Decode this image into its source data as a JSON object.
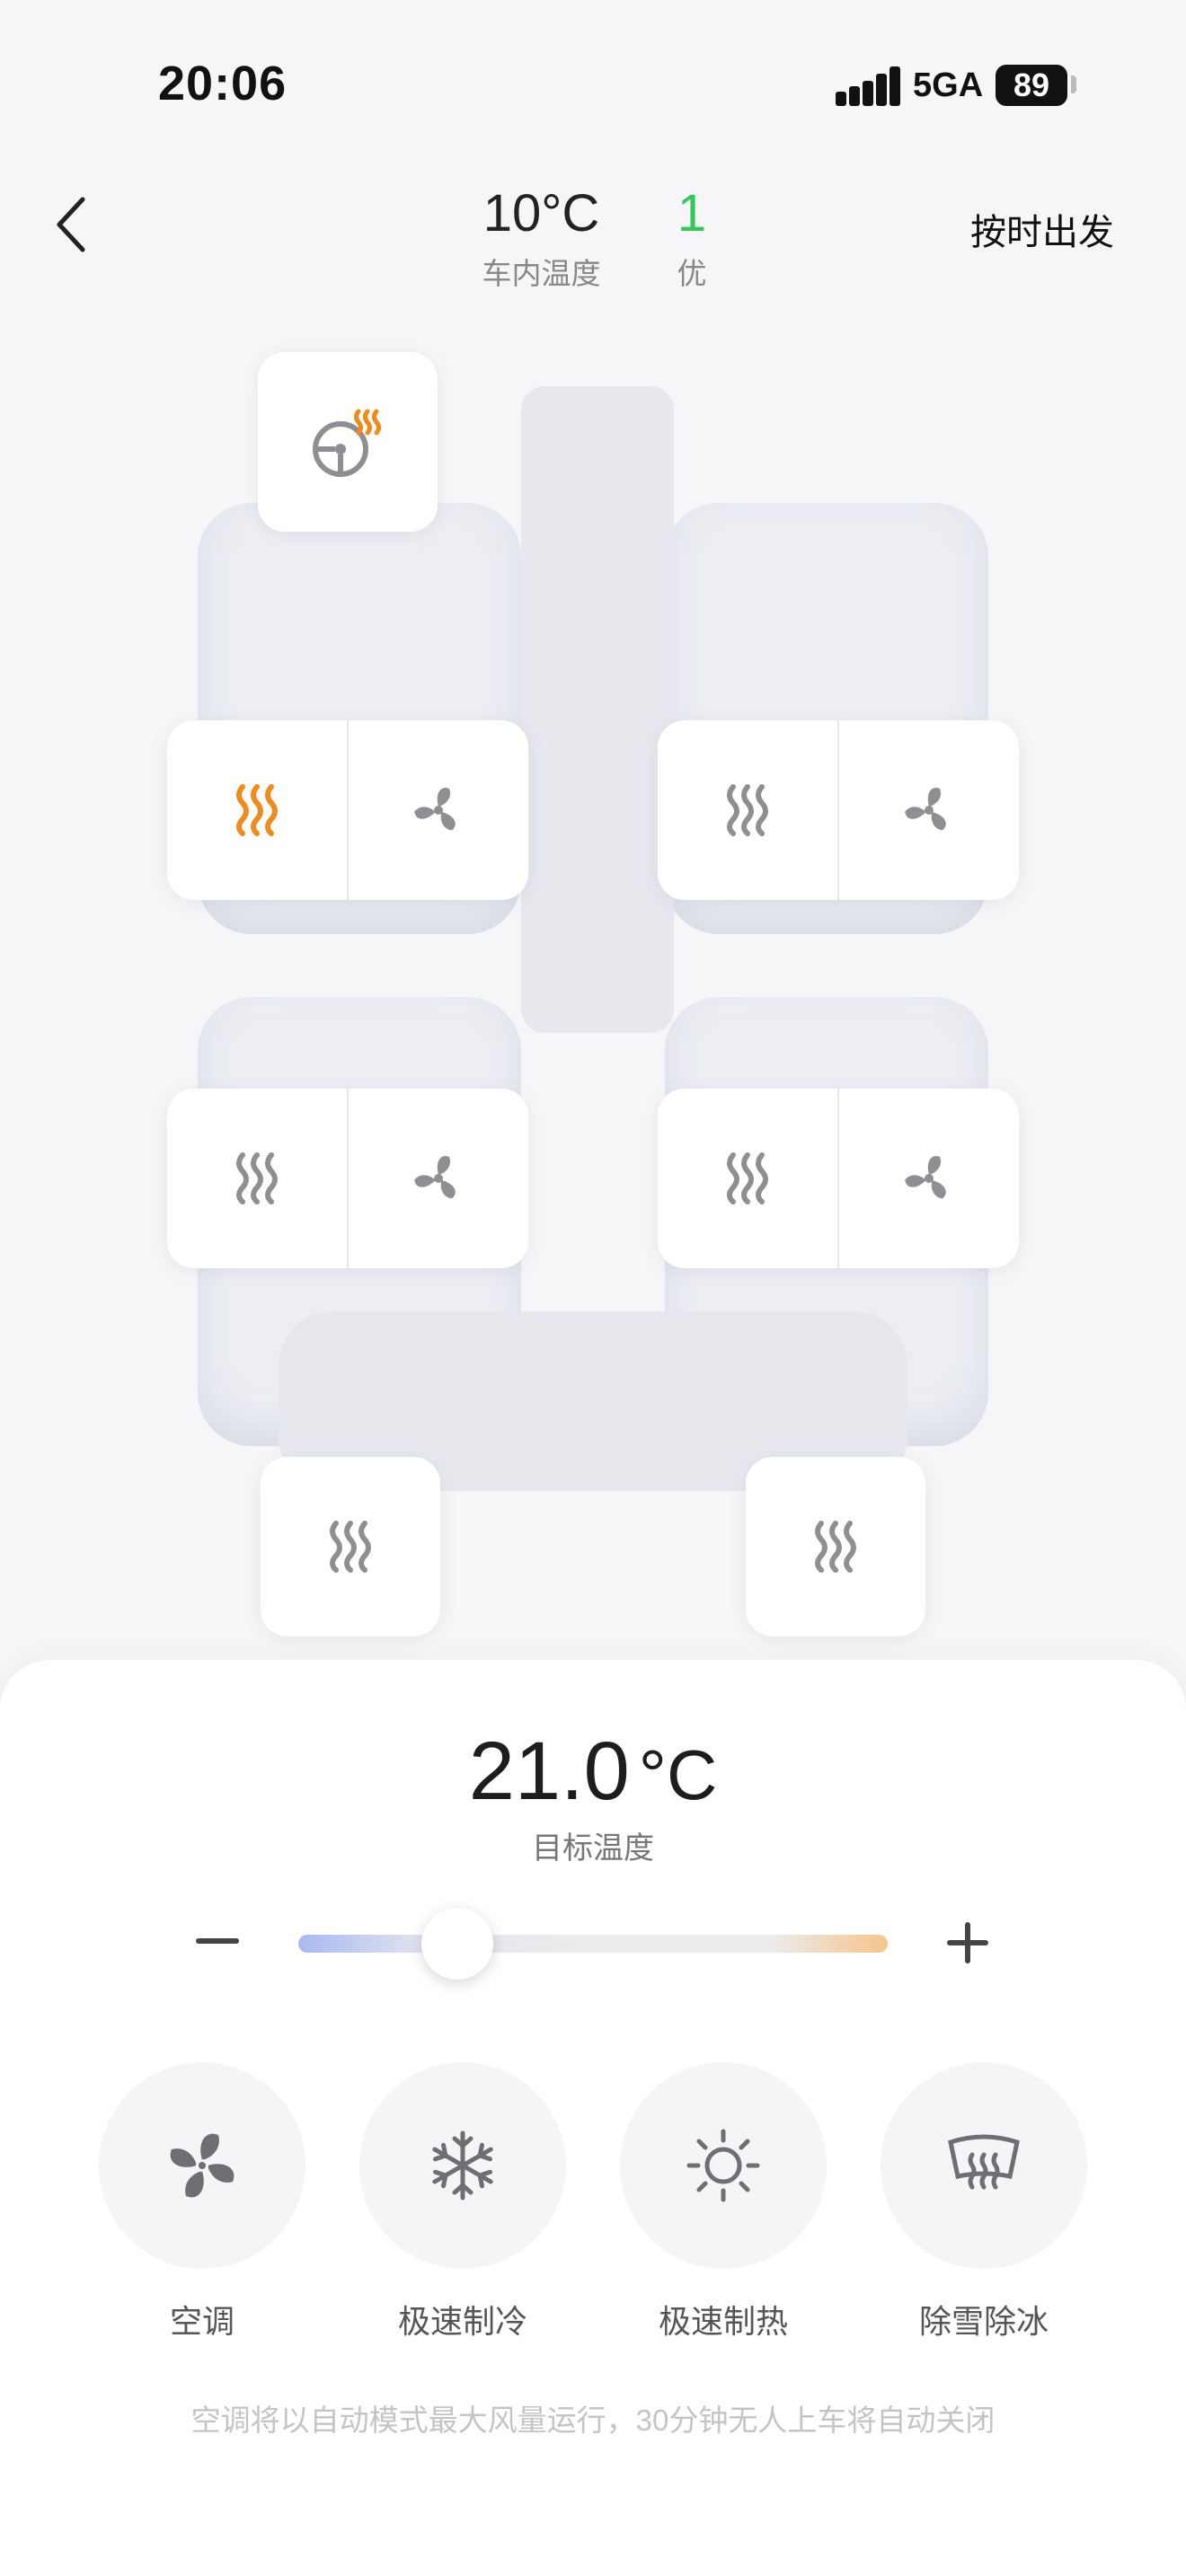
{
  "status_bar": {
    "time": "20:06",
    "network": "5GA",
    "battery": "89"
  },
  "header": {
    "cabin_temp": "10°C",
    "cabin_temp_label": "车内温度",
    "air_quality": "1",
    "air_quality_label": "优",
    "timed_departure": "按时出发"
  },
  "colors": {
    "active": "#f08a1c",
    "inactive": "#8e8e93",
    "aqi": "#34c759"
  },
  "seats": {
    "steering_wheel_heat": {
      "icon": "steering-wheel-heat-icon",
      "active": true
    },
    "front_left": {
      "heat_active": true,
      "ventilation_active": false
    },
    "front_right": {
      "heat_active": false,
      "ventilation_active": false
    },
    "rear_left": {
      "heat_active": false,
      "ventilation_active": false
    },
    "rear_right": {
      "heat_active": false,
      "ventilation_active": false
    },
    "third_left": {
      "heat_active": false
    },
    "third_right": {
      "heat_active": false
    }
  },
  "climate": {
    "target_temp": "21.0",
    "target_unit": "°C",
    "target_label": "目标温度",
    "slider_fraction": 0.27
  },
  "functions": [
    {
      "label": "空调",
      "icon": "fan-icon"
    },
    {
      "label": "极速制冷",
      "icon": "snowflake-icon"
    },
    {
      "label": "极速制热",
      "icon": "sun-icon"
    },
    {
      "label": "除雪除冰",
      "icon": "windshield-defrost-icon"
    }
  ],
  "note": "空调将以自动模式最大风量运行，30分钟无人上车将自动关闭"
}
